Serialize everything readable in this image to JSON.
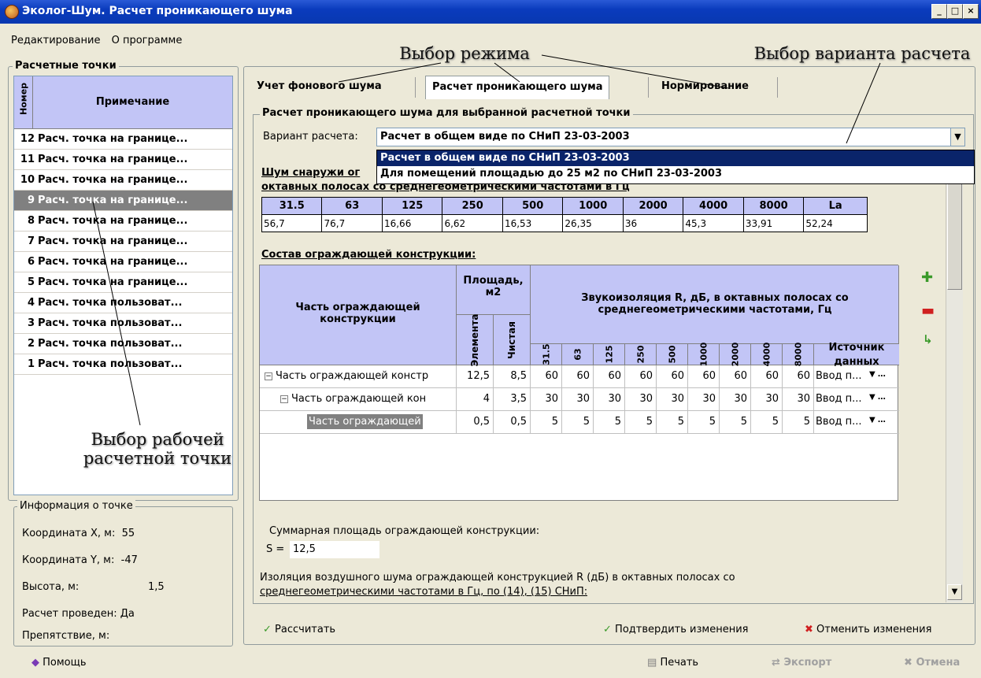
{
  "window": {
    "title": "Эколог-Шум. Расчет проникающего шума",
    "min": "_",
    "max": "□",
    "close": "×"
  },
  "menu": [
    "Редактирование",
    "О программе"
  ],
  "points": {
    "group_title": "Расчетные точки",
    "col_num": "Номер",
    "col_note": "Примечание",
    "rows": [
      {
        "n": "12",
        "note": "Расч. точка на границе..."
      },
      {
        "n": "11",
        "note": "Расч. точка на границе..."
      },
      {
        "n": "10",
        "note": "Расч. точка на границе..."
      },
      {
        "n": "9",
        "note": "Расч. точка на границе..."
      },
      {
        "n": "8",
        "note": "Расч. точка на границе..."
      },
      {
        "n": "7",
        "note": "Расч. точка на границе..."
      },
      {
        "n": "6",
        "note": "Расч. точка на границе..."
      },
      {
        "n": "5",
        "note": "Расч. точка на границе..."
      },
      {
        "n": "4",
        "note": "Расч. точка пользоват..."
      },
      {
        "n": "3",
        "note": "Расч. точка пользоват..."
      },
      {
        "n": "2",
        "note": "Расч. точка пользоват..."
      },
      {
        "n": "1",
        "note": "Расч. точка пользоват..."
      }
    ],
    "selected": "9"
  },
  "annotations": {
    "mode": "Выбор режима",
    "variant": "Выбор варианта расчета",
    "point_line1": "Выбор рабочей",
    "point_line2": "расчетной точки"
  },
  "info": {
    "title": "Информация о точке",
    "x_label": "Координата X, м:",
    "x": "55",
    "y_label": "Координата Y, м:",
    "y": "-47",
    "h_label": "Высота, м:",
    "h": "1,5",
    "calc_label": "Расчет проведен:",
    "calc": "Да",
    "obst_label": "Препятствие, м:"
  },
  "tabs": [
    "Учет фонового шума",
    "Расчет проникающего шума",
    "Нормирование"
  ],
  "panel": {
    "title": "Расчет проникающего шума для выбранной расчетной точки",
    "variant_label": "Вариант расчета:",
    "variant_value": "Расчет в общем виде по СНиП 23-03-2003",
    "options": [
      "Расчет в общем виде по СНиП 23-03-2003",
      "Для помещений площадью до 25 м2 по СНиП 23-03-2003"
    ],
    "outside_noise_a": "Шум снаружи ог",
    "outside_noise_b": "октавных полосах со среднегеометрическими частотами в Гц",
    "freq_headers": [
      "31.5",
      "63",
      "125",
      "250",
      "500",
      "1000",
      "2000",
      "4000",
      "8000",
      "La"
    ],
    "freq_values": [
      "56,7",
      "76,7",
      "16,66",
      "6,62",
      "16,53",
      "26,35",
      "36",
      "45,3",
      "33,91",
      "52,24"
    ],
    "composition_title": "Состав ограждающей конструкции:"
  },
  "grid": {
    "h_part": "Часть ограждающей конструкции",
    "h_area": "Площадь, м2",
    "h_area_elem": "Элемента",
    "h_area_clean": "Чистая",
    "h_iso": "Звукоизоляция R, дБ, в октавных полосах со среднегеометрическими частотами, Гц",
    "h_freqs": [
      "31.5",
      "63",
      "125",
      "250",
      "500",
      "1000",
      "2000",
      "4000",
      "8000"
    ],
    "h_src": "Источник данных",
    "rows": [
      {
        "name": "Часть ограждающей констр",
        "elem": "12,5",
        "clean": "8,5",
        "vals": [
          "60",
          "60",
          "60",
          "60",
          "60",
          "60",
          "60",
          "60",
          "60"
        ],
        "src": "Ввод п..."
      },
      {
        "name": "Часть ограждающей кон",
        "elem": "4",
        "clean": "3,5",
        "vals": [
          "30",
          "30",
          "30",
          "30",
          "30",
          "30",
          "30",
          "30",
          "30"
        ],
        "src": "Ввод п..."
      },
      {
        "name": "Часть ограждающей",
        "elem": "0,5",
        "clean": "0,5",
        "vals": [
          "5",
          "5",
          "5",
          "5",
          "5",
          "5",
          "5",
          "5",
          "5"
        ],
        "src": "Ввод п..."
      }
    ]
  },
  "summary": {
    "area_label": "Суммарная площадь ограждающей конструкции:",
    "s_label": "S =",
    "s_value": "12,5",
    "iso_line1": "Изоляция воздушного шума ограждающей конструкцией R (дБ) в октавных полосах со",
    "iso_line2": "среднегеометрическими частотами в Гц, по (14), (15) СНиП:"
  },
  "actions": {
    "calc": "Рассчитать",
    "confirm": "Подтвердить изменения",
    "cancel": "Отменить изменения"
  },
  "footer": {
    "help": "Помощь",
    "print": "Печать",
    "export": "Экспорт",
    "cancel": "Отмена"
  },
  "colors": {
    "header_bg": "#c2c5f6",
    "selection": "#0a246a",
    "titlebar": "#0a3bbd"
  }
}
